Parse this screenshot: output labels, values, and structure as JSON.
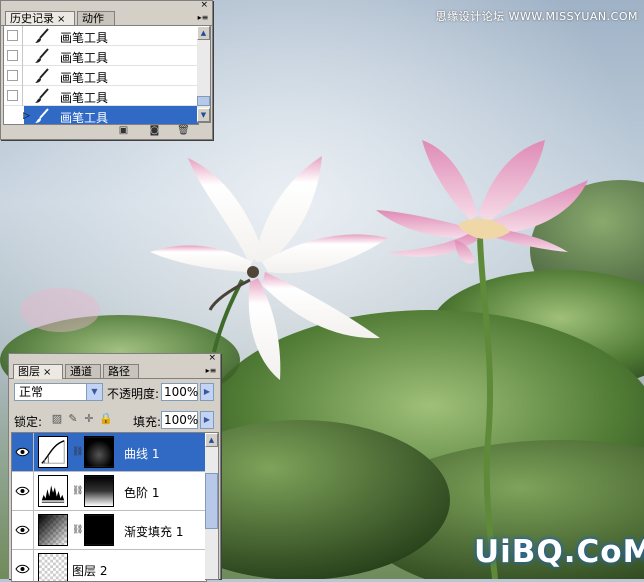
{
  "watermark_top": "思缘设计论坛 WWW.MISSYUAN.COM",
  "watermark_bottom": "UiBQ.CoM",
  "history_panel": {
    "close": "×",
    "tabs": [
      {
        "label": "历史记录",
        "active": true
      },
      {
        "label": "动作",
        "active": false
      }
    ],
    "menu_arrow": "▸≡",
    "items": [
      {
        "label": "画笔工具",
        "selected": false
      },
      {
        "label": "画笔工具",
        "selected": false
      },
      {
        "label": "画笔工具",
        "selected": false
      },
      {
        "label": "画笔工具",
        "selected": false
      },
      {
        "label": "画笔工具",
        "selected": true
      }
    ],
    "footer_icons": [
      "new-document-icon",
      "snapshot-camera-icon",
      "trash-icon"
    ]
  },
  "layers_panel": {
    "close": "×",
    "tabs": [
      {
        "label": "图层",
        "active": true
      },
      {
        "label": "通道",
        "active": false
      },
      {
        "label": "路径",
        "active": false
      }
    ],
    "blend_mode": "正常",
    "opacity_label": "不透明度:",
    "opacity_value": "100%",
    "lock_label": "锁定:",
    "fill_label": "填充:",
    "fill_value": "100%",
    "layers": [
      {
        "name": "曲线 1",
        "selected": true,
        "kind": "curves"
      },
      {
        "name": "色阶 1",
        "selected": false,
        "kind": "levels"
      },
      {
        "name": "渐变填充 1",
        "selected": false,
        "kind": "gradient"
      },
      {
        "name": "图层 2",
        "selected": false,
        "kind": "pixel"
      }
    ]
  },
  "colors": {
    "selection": "#316ac5",
    "panel_bg": "#d4d0c8",
    "petal_pink": "#e58fb8"
  }
}
